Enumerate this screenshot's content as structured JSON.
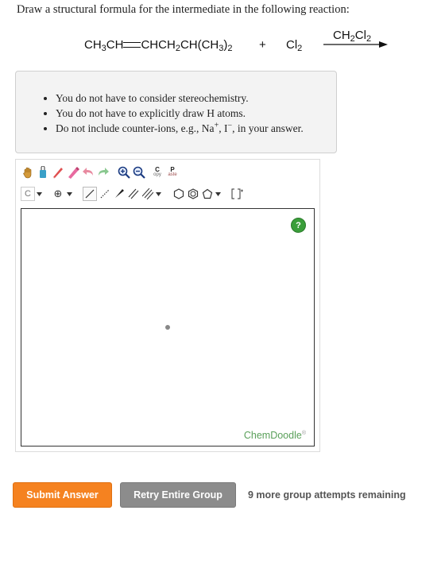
{
  "question": "Draw a structural formula for the intermediate in the following reaction:",
  "reaction": {
    "reactant_part1": "CH",
    "reactant_sub1": "3",
    "reactant_part2": "CH",
    "reactant_part3": "CHCH",
    "reactant_sub2": "2",
    "reactant_part4": "CH(CH",
    "reactant_sub3": "3",
    "reactant_part5": ")",
    "reactant_sub4": "2",
    "plus": "+",
    "reagent": "Cl",
    "reagent_sub": "2",
    "solvent_part1": "CH",
    "solvent_sub1": "2",
    "solvent_part2": "Cl",
    "solvent_sub2": "2"
  },
  "notes": {
    "item1": "You do not have to consider stereochemistry.",
    "item2": "You do not have to explicitly draw H atoms.",
    "item3_before": "Do not include counter-ions, e.g., Na",
    "item3_sup1": "+",
    "item3_mid": ", I",
    "item3_sup2": "−",
    "item3_after": ", in your answer."
  },
  "editor": {
    "toolbar_row1": [
      "hand-tool",
      "eraser",
      "pencil",
      "undo",
      "redo",
      "zoom-in",
      "zoom-out",
      "copy",
      "paste"
    ],
    "copy_label_top": "C",
    "copy_label_bottom": "opy",
    "paste_label_top": "P",
    "paste_label_bottom": "aste",
    "atom_label": "C",
    "charge_label": "⊕",
    "help_label": "?",
    "brand": "ChemDoodle",
    "brand_mark": "®"
  },
  "buttons": {
    "submit": "Submit Answer",
    "retry": "Retry Entire Group"
  },
  "status": {
    "remaining": "9 more group attempts remaining"
  },
  "colors": {
    "submit": "#f58220",
    "retry": "#8c8c8c",
    "help": "#3a9e3a",
    "brand": "#5aa05a"
  }
}
